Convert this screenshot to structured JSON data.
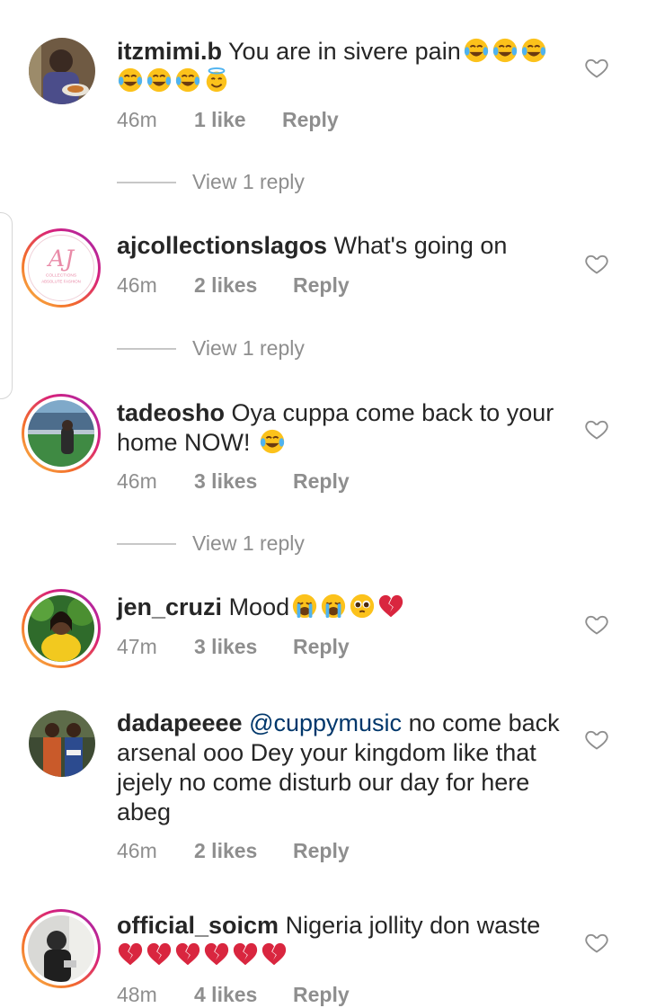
{
  "comments": [
    {
      "username": "itzmimi.b",
      "text": "You are in sivere pain",
      "emojis_line1": [
        "laugh-cry",
        "laugh-cry",
        "laugh-cry"
      ],
      "emojis_line2": [
        "laugh-cry",
        "laugh-cry",
        "laugh-cry",
        "halo"
      ],
      "time": "46m",
      "likes": "1 like",
      "reply": "Reply",
      "view_replies": "View 1 reply"
    },
    {
      "username": "ajcollectionslagos",
      "text": "What's going on",
      "avatar_monogram": "AJ",
      "avatar_sub": "COLLECTIONS",
      "avatar_sub2": "ABSOLUTE FASHION",
      "time": "46m",
      "likes": "2 likes",
      "reply": "Reply",
      "view_replies": "View 1 reply"
    },
    {
      "username": "tadeosho",
      "text": "Oya cuppa come back to your home NOW!",
      "emojis": [
        "laugh-cry"
      ],
      "time": "46m",
      "likes": "3 likes",
      "reply": "Reply",
      "view_replies": "View 1 reply"
    },
    {
      "username": "jen_cruzi",
      "text": "Mood",
      "emojis": [
        "loud-cry",
        "loud-cry",
        "pleading",
        "broken-heart"
      ],
      "time": "47m",
      "likes": "3 likes",
      "reply": "Reply"
    },
    {
      "username": "dadapeeee",
      "mention": "@cuppymusic",
      "text": "no come back arsenal ooo Dey your kingdom like that jejely no come disturb our day for here abeg",
      "time": "46m",
      "likes": "2 likes",
      "reply": "Reply"
    },
    {
      "username": "official_soicm",
      "text": "Nigeria jollity don waste",
      "emojis_line2": [
        "broken-heart",
        "broken-heart",
        "broken-heart",
        "broken-heart",
        "broken-heart",
        "broken-heart"
      ],
      "time": "48m",
      "likes": "4 likes",
      "reply": "Reply"
    }
  ],
  "colors": {
    "text": "#262626",
    "meta": "#8e8e8e",
    "mention": "#00376b",
    "divider": "#c7c7c7"
  },
  "icons": {
    "like": "heart-outline-icon",
    "laugh": "laughing-crying-emoji",
    "halo": "halo-smile-emoji",
    "loud": "loudly-crying-emoji",
    "plead": "pleading-face-emoji",
    "broken": "broken-heart-emoji"
  }
}
